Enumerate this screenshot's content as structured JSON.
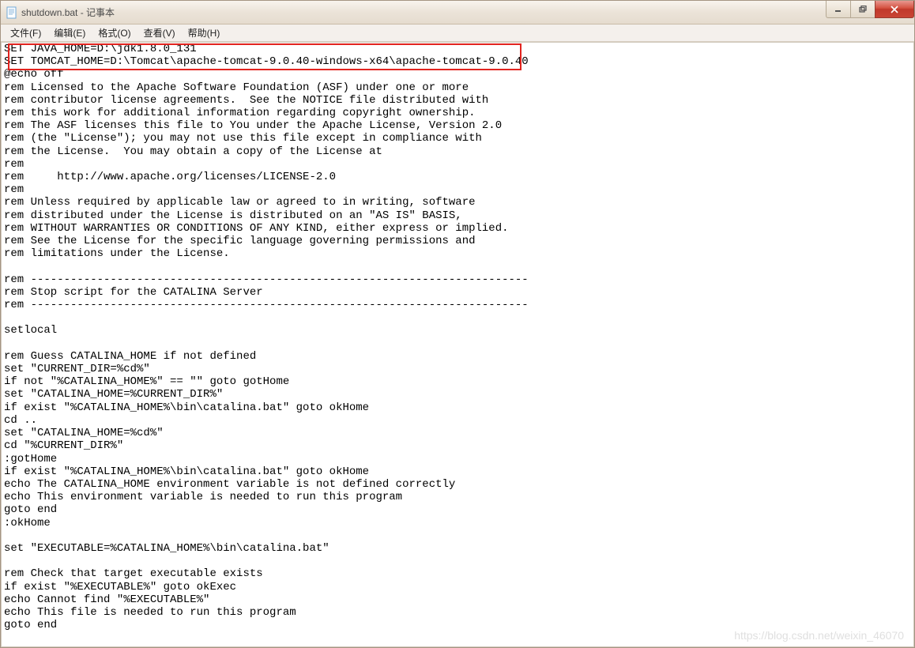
{
  "window": {
    "title": "shutdown.bat - 记事本"
  },
  "menu": {
    "file": "文件(F)",
    "edit": "编辑(E)",
    "format": "格式(O)",
    "view": "查看(V)",
    "help": "帮助(H)"
  },
  "editor": {
    "content": "SET JAVA_HOME=D:\\jdk1.8.0_131\nSET TOMCAT_HOME=D:\\Tomcat\\apache-tomcat-9.0.40-windows-x64\\apache-tomcat-9.0.40\n@echo off\nrem Licensed to the Apache Software Foundation (ASF) under one or more\nrem contributor license agreements.  See the NOTICE file distributed with\nrem this work for additional information regarding copyright ownership.\nrem The ASF licenses this file to You under the Apache License, Version 2.0\nrem (the \"License\"); you may not use this file except in compliance with\nrem the License.  You may obtain a copy of the License at\nrem\nrem     http://www.apache.org/licenses/LICENSE-2.0\nrem\nrem Unless required by applicable law or agreed to in writing, software\nrem distributed under the License is distributed on an \"AS IS\" BASIS,\nrem WITHOUT WARRANTIES OR CONDITIONS OF ANY KIND, either express or implied.\nrem See the License for the specific language governing permissions and\nrem limitations under the License.\n\nrem ---------------------------------------------------------------------------\nrem Stop script for the CATALINA Server\nrem ---------------------------------------------------------------------------\n\nsetlocal\n\nrem Guess CATALINA_HOME if not defined\nset \"CURRENT_DIR=%cd%\"\nif not \"%CATALINA_HOME%\" == \"\" goto gotHome\nset \"CATALINA_HOME=%CURRENT_DIR%\"\nif exist \"%CATALINA_HOME%\\bin\\catalina.bat\" goto okHome\ncd ..\nset \"CATALINA_HOME=%cd%\"\ncd \"%CURRENT_DIR%\"\n:gotHome\nif exist \"%CATALINA_HOME%\\bin\\catalina.bat\" goto okHome\necho The CATALINA_HOME environment variable is not defined correctly\necho This environment variable is needed to run this program\ngoto end\n:okHome\n\nset \"EXECUTABLE=%CATALINA_HOME%\\bin\\catalina.bat\"\n\nrem Check that target executable exists\nif exist \"%EXECUTABLE%\" goto okExec\necho Cannot find \"%EXECUTABLE%\"\necho This file is needed to run this program\ngoto end"
  },
  "watermark": "https://blog.csdn.net/weixin_46070"
}
